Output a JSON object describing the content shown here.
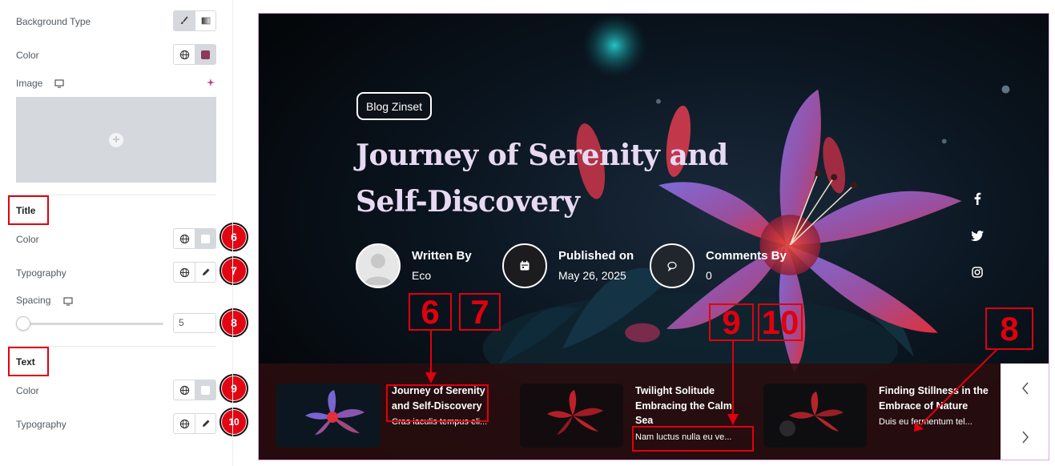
{
  "panel": {
    "background_type_label": "Background Type",
    "color_label": "Color",
    "image_label": "Image",
    "title_section": "Title",
    "title_color_label": "Color",
    "title_typography_label": "Typography",
    "spacing_label": "Spacing",
    "spacing_value": "5",
    "text_section": "Text",
    "text_color_label": "Color",
    "text_typography_label": "Typography",
    "badges": [
      "6",
      "7",
      "8",
      "9",
      "10"
    ],
    "swatch_color": "#8b3a5c"
  },
  "hero": {
    "tag": "Blog Zinset",
    "title": "Journey of Serenity and Self-Discovery",
    "meta": [
      {
        "key": "Written By",
        "value": "Eco"
      },
      {
        "key": "Published on",
        "value": "May 26, 2025"
      },
      {
        "key": "Comments By",
        "value": "0"
      }
    ],
    "social": [
      "facebook-icon",
      "twitter-icon",
      "instagram-icon"
    ]
  },
  "callouts": [
    "6",
    "7",
    "9",
    "10",
    "8"
  ],
  "cards": [
    {
      "title": "Journey of Serenity and Self-Discovery",
      "text": "Cras iaculis tempus eli..."
    },
    {
      "title": "Twilight Solitude Embracing the Calm Sea",
      "text": "Nam luctus nulla eu ve..."
    },
    {
      "title": "Finding Stillness in the Embrace of Nature",
      "text": "Duis eu fermentum tel..."
    }
  ],
  "colors": {
    "annotation_red": "#e0000e",
    "title_color": "#e8d9f3",
    "preview_border": "#d8a9ea"
  }
}
